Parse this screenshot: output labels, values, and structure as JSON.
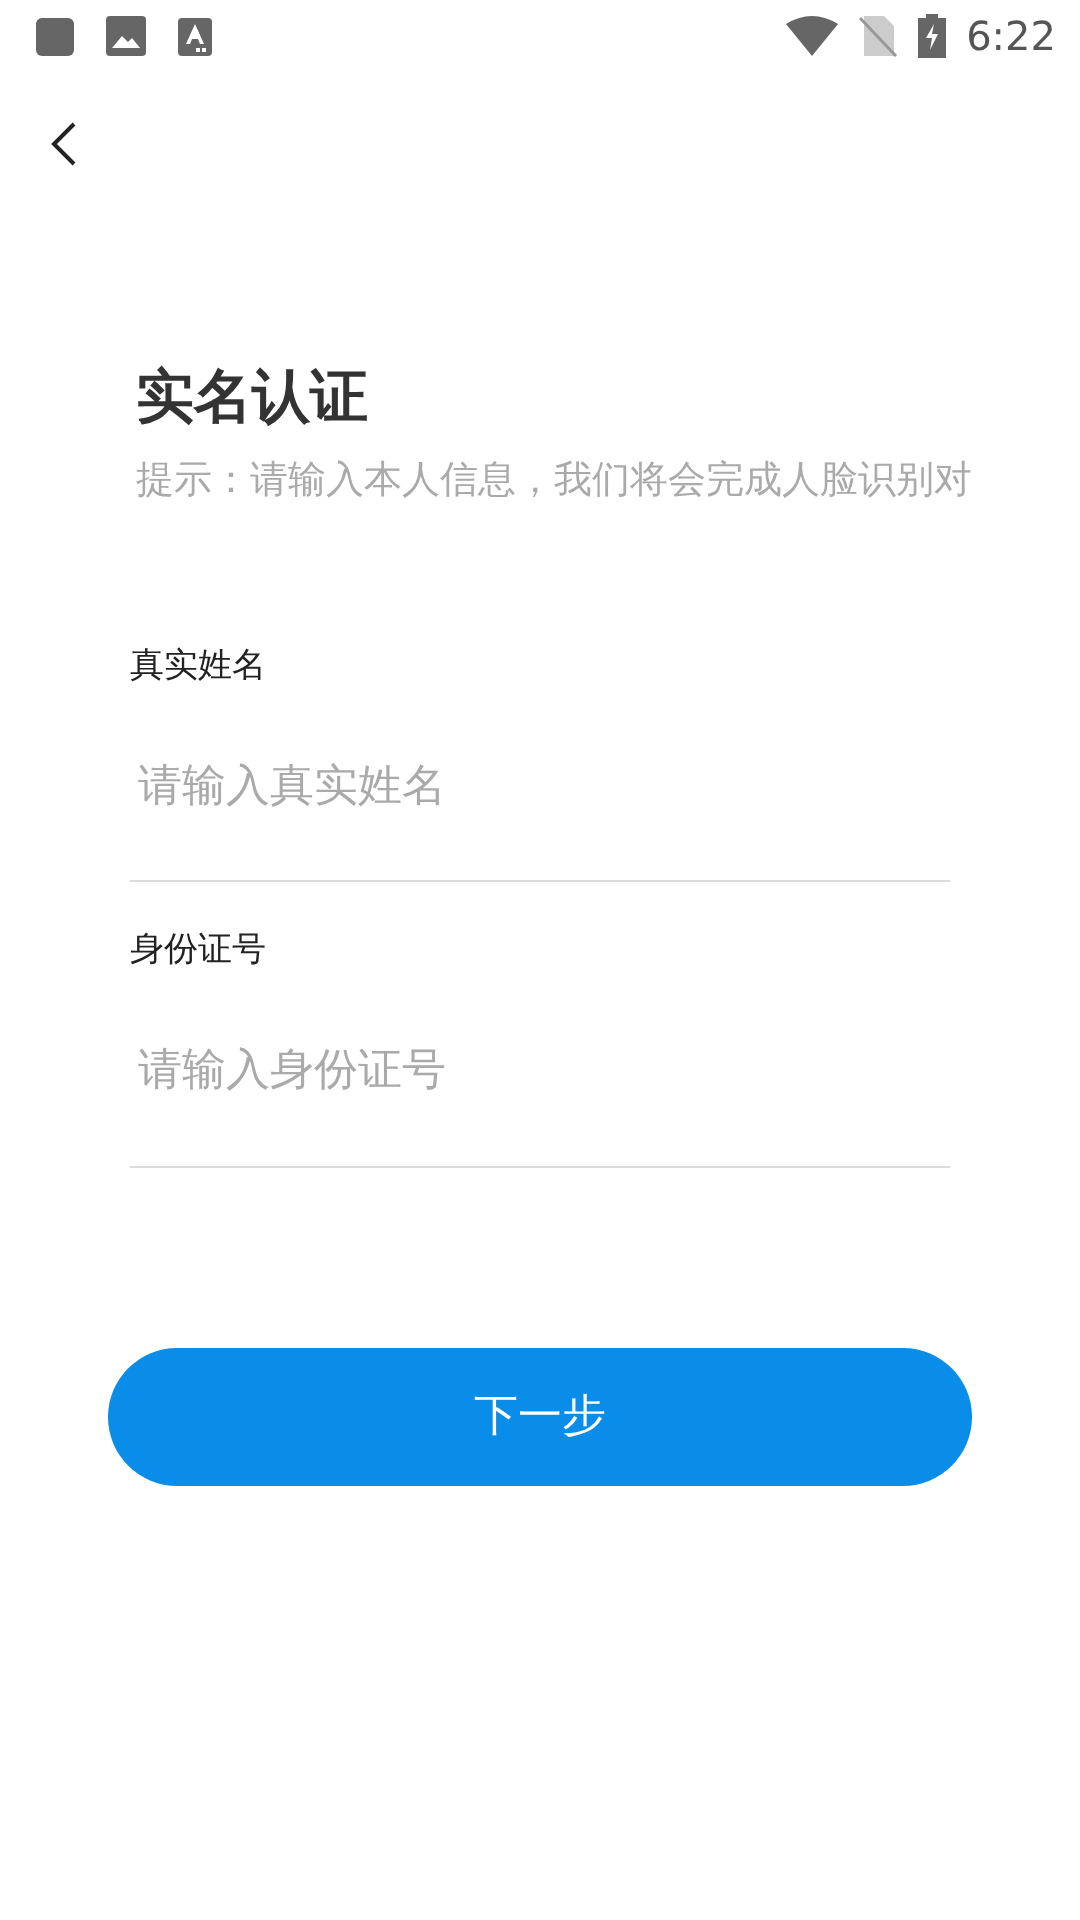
{
  "status_bar": {
    "time": "6:22"
  },
  "title": "实名认证",
  "hint": "提示：请输入本人信息，我们将会完成人脸识别对",
  "fields": [
    {
      "label": "真实姓名",
      "placeholder": "请输入真实姓名"
    },
    {
      "label": "身份证号",
      "placeholder": "请输入身份证号"
    }
  ],
  "next_button": "下一步"
}
